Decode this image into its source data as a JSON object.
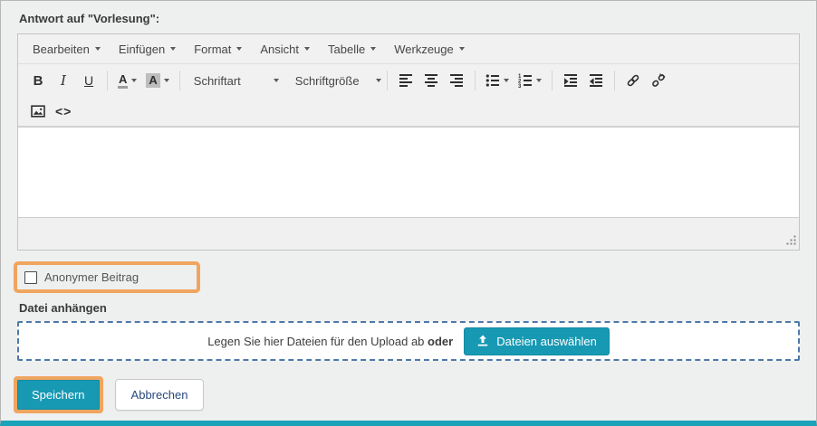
{
  "window": {
    "title": "Antwort auf \"Vorlesung\":"
  },
  "editor": {
    "menu": [
      {
        "label": "Bearbeiten"
      },
      {
        "label": "Einfügen"
      },
      {
        "label": "Format"
      },
      {
        "label": "Ansicht"
      },
      {
        "label": "Tabelle"
      },
      {
        "label": "Werkzeuge"
      }
    ],
    "toolbar": {
      "bold": "B",
      "italic": "I",
      "underline": "U",
      "forecolor": "A",
      "backcolor": "A",
      "font_family": "Schriftart",
      "font_size": "Schriftgröße",
      "code": "<>"
    },
    "body_text": ""
  },
  "anonymous_checkbox": {
    "label": "Anonymer Beitrag",
    "checked": false
  },
  "attachment": {
    "heading": "Datei anhängen",
    "dropzone_text": "Legen Sie hier Dateien für den Upload ab",
    "dropzone_conjunction": "oder",
    "select_files_button": "Dateien auswählen"
  },
  "actions": {
    "save": "Speichern",
    "cancel": "Abbrechen"
  },
  "colors": {
    "accent_teal": "#1799b3",
    "highlight_orange": "#f0a55f",
    "dropzone_border": "#4d79a9",
    "bottom_bar_teal": "#1aa2b8"
  }
}
